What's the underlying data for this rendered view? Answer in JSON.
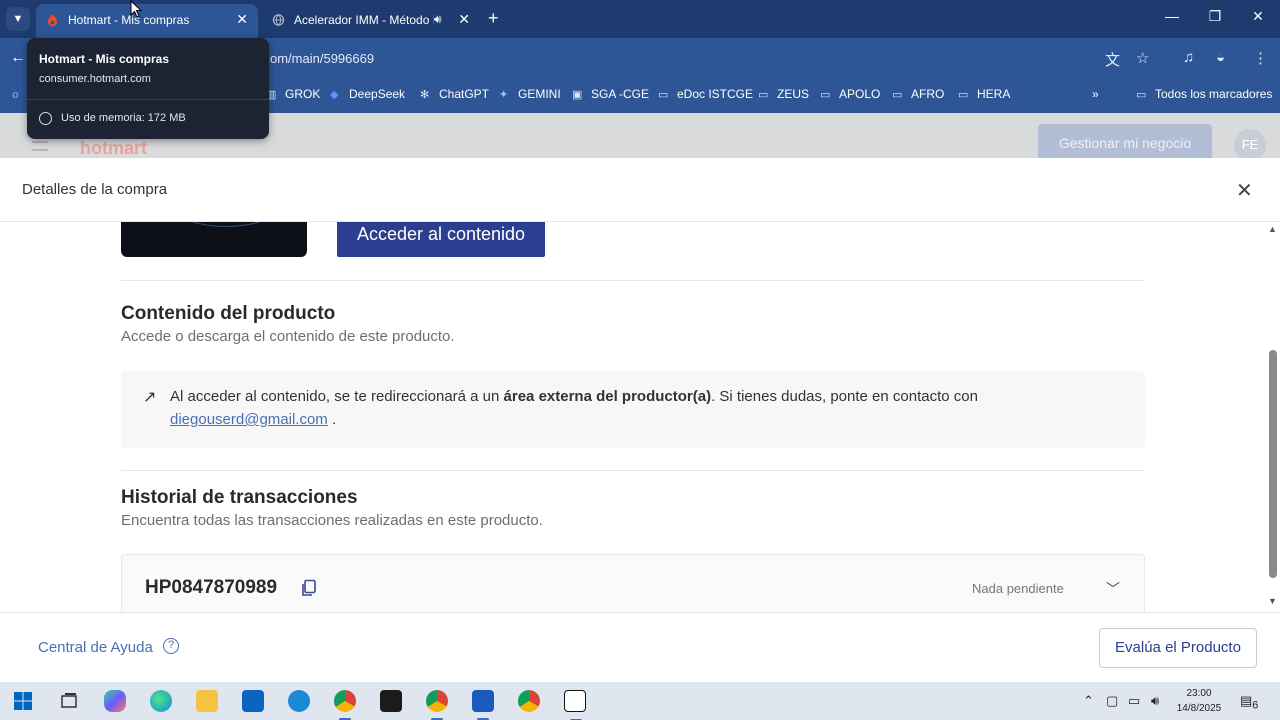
{
  "browser": {
    "tabs": [
      {
        "title": "Hotmart - Mis compras",
        "active": true
      },
      {
        "title": "Acelerador IMM - Método I",
        "active": false
      }
    ],
    "url_visible": "om/main/5996669",
    "tooltip": {
      "title": "Hotmart - Mis compras",
      "domain": "consumer.hotmart.com",
      "memory": "Uso de memoria: 172 MB"
    },
    "bookmarks": [
      {
        "label": "GROK",
        "icon": "grok-icon"
      },
      {
        "label": "DeepSeek",
        "icon": "deepseek-icon"
      },
      {
        "label": "ChatGPT",
        "icon": "chatgpt-icon"
      },
      {
        "label": "GEMINI",
        "icon": "gemini-icon"
      },
      {
        "label": "SGA -CGE",
        "icon": "sga-icon"
      },
      {
        "label": "eDoc ISTCGE",
        "icon": "folder-icon"
      },
      {
        "label": "ZEUS",
        "icon": "folder-icon"
      },
      {
        "label": "APOLO",
        "icon": "folder-icon"
      },
      {
        "label": "AFRO",
        "icon": "folder-icon"
      },
      {
        "label": "HERA",
        "icon": "folder-icon"
      }
    ],
    "all_bookmarks": "Todos los marcadores"
  },
  "page_header": {
    "logo": "hotmart",
    "manage_button": "Gestionar mi negocio",
    "avatar": "FE"
  },
  "modal": {
    "title": "Detalles de la compra",
    "access_button": "Acceder al contenido",
    "content_section": {
      "title": "Contenido del producto",
      "subtitle": "Accede o descarga el contenido de este producto.",
      "notice_pre": "Al acceder al contenido, se te redireccionará a un ",
      "notice_bold": "área externa del productor(a)",
      "notice_post": ". Si tienes dudas, ponte en contacto con",
      "email": "diegouserd@gmail.com",
      "email_suffix": " ."
    },
    "history_section": {
      "title": "Historial de transacciones",
      "subtitle": "Encuentra todas las transacciones realizadas en este producto.",
      "transaction_id": "HP0847870989",
      "status": "Nada pendiente"
    },
    "footer": {
      "help": "Central de Ayuda",
      "rate_button": "Evalúa el Producto"
    }
  },
  "taskbar": {
    "time": "23:00",
    "date": "14/8/2025",
    "notifications": "6"
  },
  "colors": {
    "tab_strip": "#1d3b6e",
    "toolbar": "#2e5596",
    "primary_button": "#2c3e8f",
    "link": "#4a6fb5"
  }
}
